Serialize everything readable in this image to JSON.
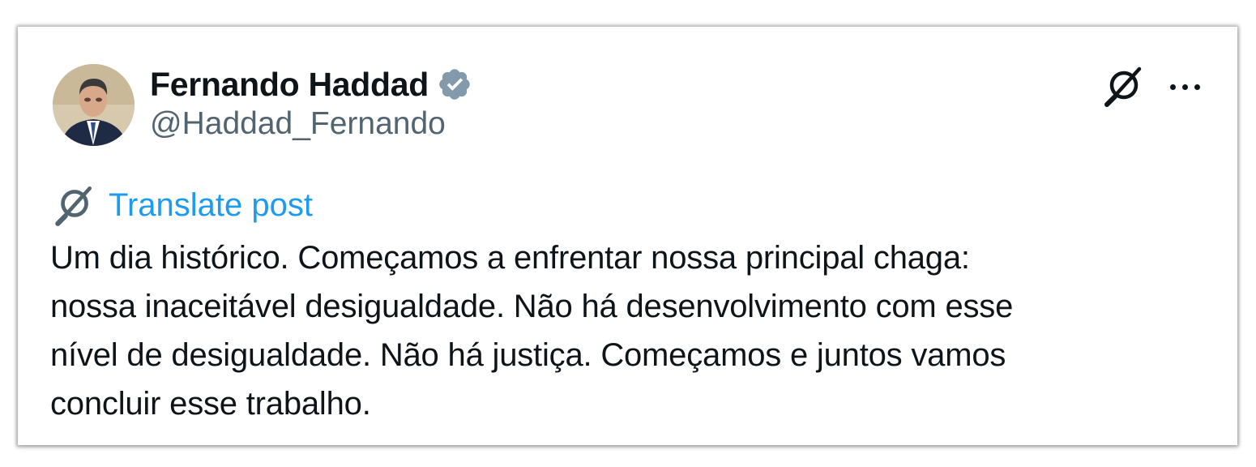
{
  "post": {
    "author": {
      "display_name": "Fernando Haddad",
      "handle": "@Haddad_Fernando",
      "verified": true,
      "avatar_icon": "profile-photo"
    },
    "actions": {
      "grok_icon": "grok-icon",
      "more_icon": "more-horizontal-icon"
    },
    "translate_label": "Translate post",
    "body_lines": [
      "Um dia histórico. Começamos a enfrentar nossa principal chaga:",
      "nossa inaceitável desigualdade. Não há desenvolvimento com esse",
      "nível de desigualdade. Não há justiça. Começamos e juntos vamos",
      "concluir esse trabalho."
    ]
  },
  "colors": {
    "text_primary": "#0f1419",
    "text_secondary": "#536471",
    "link_blue": "#1d9bf0",
    "verified_badge": "#829aab"
  }
}
